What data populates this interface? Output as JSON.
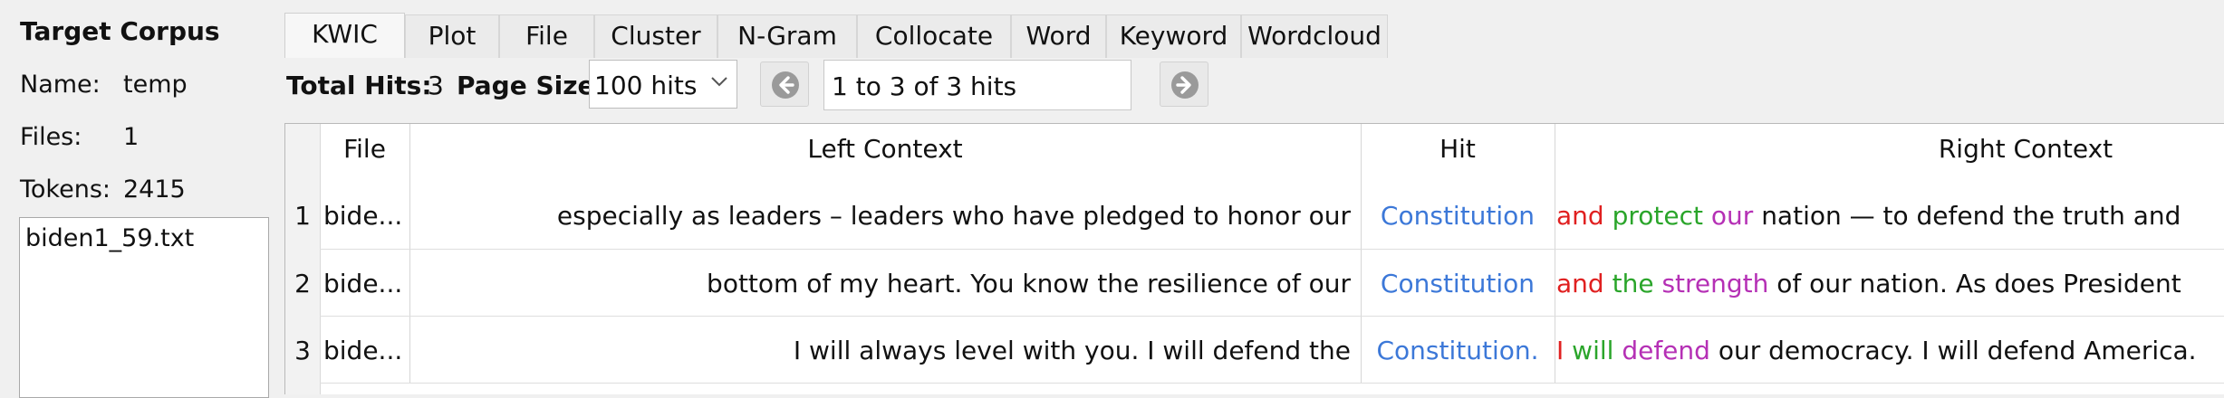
{
  "left_panel": {
    "title": "Target Corpus",
    "name_label": "Name:",
    "name_value": "temp",
    "files_label": "Files:",
    "files_value": "1",
    "tokens_label": "Tokens:",
    "tokens_value": "2415",
    "files": [
      "biden1_59.txt"
    ]
  },
  "tabs": [
    "KWIC",
    "Plot",
    "File",
    "Cluster",
    "N-Gram",
    "Collocate",
    "Word",
    "Keyword",
    "Wordcloud"
  ],
  "active_tab": "KWIC",
  "toolbar": {
    "total_hits_label": "Total Hits:",
    "total_hits_value": "3",
    "page_size_label": "Page Size",
    "page_size_value": "100 hits",
    "page_info": "1 to 3 of 3 hits",
    "prev_icon": "arrow-left-circle-icon",
    "next_icon": "arrow-right-circle-icon"
  },
  "table": {
    "headers": {
      "file": "File",
      "left": "Left Context",
      "hit": "Hit",
      "right": "Right Context"
    },
    "colors": {
      "hit": "#3c78d8",
      "r1": "#e02020",
      "r2": "#2aa52a",
      "r3": "#b530b5"
    },
    "rows": [
      {
        "num": "1",
        "file": "bide...",
        "left": "especially as leaders – leaders who have pledged to honor our",
        "hit": "Constitution",
        "r1": "and",
        "r2": "protect",
        "r3": "our",
        "rest": "nation — to defend the truth and"
      },
      {
        "num": "2",
        "file": "bide...",
        "left": "bottom of my heart. You know the resilience of our",
        "hit": "Constitution",
        "r1": "and",
        "r2": "the",
        "r3": "strength",
        "rest": "of our nation. As does President"
      },
      {
        "num": "3",
        "file": "bide...",
        "left": "I will always level with you. I will defend the",
        "hit": "Constitution.",
        "r1": "I",
        "r2": "will",
        "r3": "defend",
        "rest": "our democracy. I will defend America."
      }
    ]
  }
}
